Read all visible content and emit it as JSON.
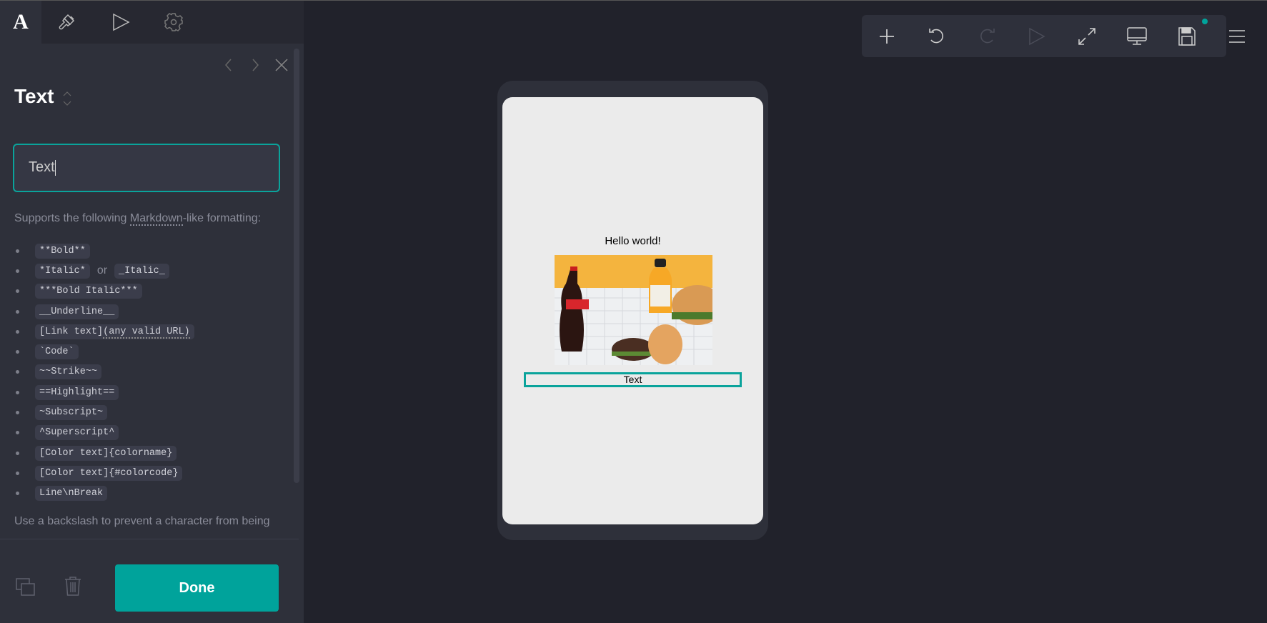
{
  "sidebar_tabs": [
    {
      "name": "text",
      "glyph": "A"
    },
    {
      "name": "style"
    },
    {
      "name": "preview"
    },
    {
      "name": "settings"
    }
  ],
  "editor": {
    "title": "Text",
    "input_value": "Text",
    "description_prefix": "Supports the following ",
    "description_link": "Markdown",
    "description_suffix": "-like formatting:",
    "formats": [
      "**Bold**",
      "*Italic*",
      "or",
      "_Italic_",
      "***Bold Italic***",
      "__Underline__",
      "[Link text]",
      "(any valid URL)",
      "`Code`",
      "~~Strike~~",
      "==Highlight==",
      "~Subscript~",
      "^Superscript^",
      "[Color text]{colorname}",
      "[Color text]{#colorcode}",
      "Line\\nBreak"
    ],
    "backslash_note": "Use a backslash to prevent a character from being",
    "done_label": "Done"
  },
  "toolbar": [
    "add",
    "undo",
    "redo",
    "play",
    "fullscreen",
    "desktop-preview",
    "save",
    "menu"
  ],
  "preview": {
    "hello": "Hello world!",
    "selected_text": "Text"
  },
  "colors": {
    "accent": "#00a39b",
    "panel": "#2e303a",
    "background": "#21222b"
  }
}
